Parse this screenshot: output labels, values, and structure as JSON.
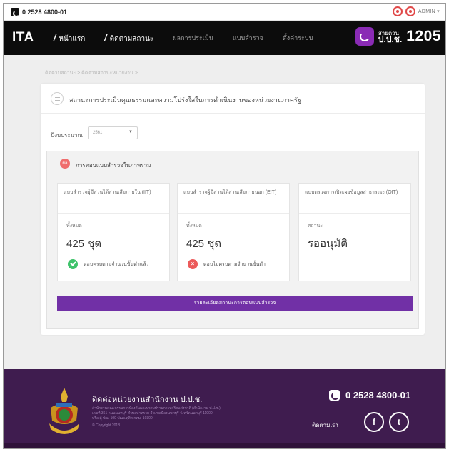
{
  "topbar": {
    "phone": "0 2528 4800-01",
    "user": "ADMIN ▾",
    "icons": [
      "pdf-icon",
      "pdf-icon"
    ]
  },
  "navbar": {
    "logo": "ITA",
    "items": [
      {
        "label": "หน้าแรก",
        "slash": "/"
      },
      {
        "label": "ติดตามสถานะ",
        "slash": "/"
      },
      {
        "label": "ผลการประเมิน"
      },
      {
        "label": "แบบสำรวจ"
      },
      {
        "label": "ตั้งค่าระบบ"
      }
    ],
    "hotline": {
      "line1": "สายด่วน",
      "line2": "ป.ป.ช.",
      "number": "1205"
    }
  },
  "breadcrumb": "ติดตามสถานะ > ติดตามสถานะหน่วยงาน >",
  "panel": {
    "title": "สถานะการประเมินคุณธรรมและความโปร่งใสในการดำเนินงานของหน่วยงานภาครัฐ",
    "budget_label": "ปีงบประมาณ",
    "budget_value": "2561",
    "summary_badge": "ผล",
    "summary_title": "การตอบแบบสำรวจในภาพรวม",
    "cards": [
      {
        "title": "แบบสำรวจผู้มีส่วนได้ส่วนเสียภายใน (IIT)",
        "sub": "ทั้งหมด",
        "count": "425 ชุด",
        "status": "ตอบครบตามจำนวนขั้นต่ำแล้ว",
        "status_type": "ok"
      },
      {
        "title": "แบบสำรวจผู้มีส่วนได้ส่วนเสียภายนอก (EIT)",
        "sub": "ทั้งหมด",
        "count": "425 ชุด",
        "status": "ตอบไม่ครบตามจำนวนขั้นต่ำ",
        "status_type": "bad"
      },
      {
        "title": "แบบตรวจการเปิดเผยข้อมูลสาธารณะ (OIT)",
        "sub": "สถานะ",
        "count": "รออนุมัติ",
        "status": "",
        "status_type": "none"
      }
    ],
    "report_button": "รายละเอียดสถานะการตอบแบบสำรวจ"
  },
  "footer": {
    "title": "ติดต่อหน่วยงานสำนักงาน ป.ป.ช.",
    "lines": [
      "สำนักงานคณะกรรมการป้องกันและปราบปรามการทุจริตแห่งชาติ (สำนักงาน ป.ป.ช.)",
      "เลขที่ 361 ถนนนนทบุรี ตำบลท่าทราย อำเภอเมืองนนทบุรี จังหวัดนนทบุรี 11000",
      "หรือ ตู้ ปณ. 100 ปณจ.ดุสิต กทม. 10300",
      "© Copyright 2018"
    ],
    "phone": "0 2528 4800-01",
    "follow": "ติดตามเรา",
    "social": [
      "f",
      "t"
    ],
    "brand_color": "#3f1c4f",
    "accent_color": "#7130a6"
  }
}
